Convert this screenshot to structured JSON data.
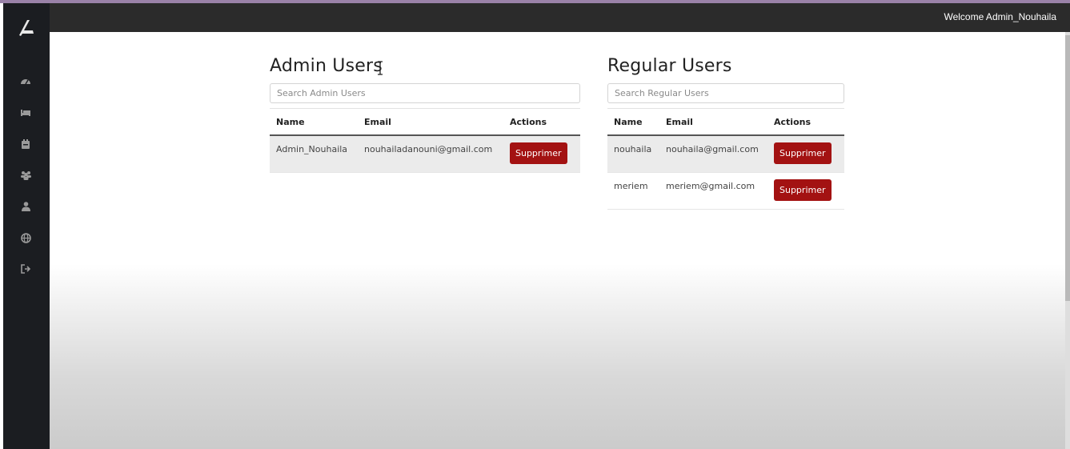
{
  "header": {
    "welcome": "Welcome Admin_Nouhaila"
  },
  "sidebar": {
    "icons": [
      "dashboard-icon",
      "bed-icon",
      "calendar-icon",
      "users-icon",
      "user-icon",
      "globe-icon",
      "logout-icon"
    ]
  },
  "admin_panel": {
    "title": "Admin Users",
    "search_placeholder": "Search Admin Users",
    "columns": [
      "Name",
      "Email",
      "Actions"
    ],
    "rows": [
      {
        "name": "Admin_Nouhaila",
        "email": "nouhailadanouni@gmail.com",
        "action": "Supprimer"
      }
    ]
  },
  "regular_panel": {
    "title": "Regular Users",
    "search_placeholder": "Search Regular Users",
    "columns": [
      "Name",
      "Email",
      "Actions"
    ],
    "rows": [
      {
        "name": "nouhaila",
        "email": "nouhaila@gmail.com",
        "action": "Supprimer"
      },
      {
        "name": "meriem",
        "email": "meriem@gmail.com",
        "action": "Supprimer"
      }
    ]
  },
  "colors": {
    "sidebar": "#1b1d21",
    "topbar": "#2b2b2b",
    "danger": "#a31212"
  }
}
